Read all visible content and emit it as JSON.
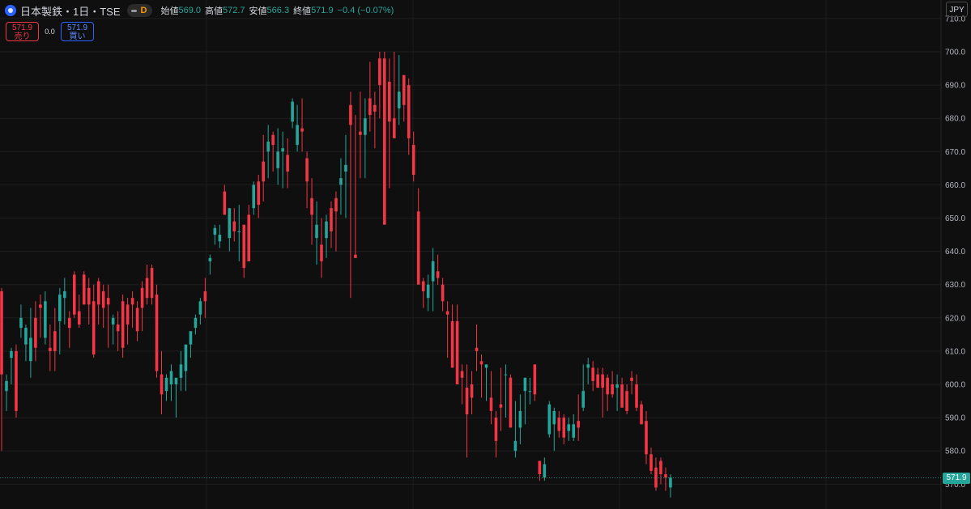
{
  "header": {
    "symbol_title": "日本製鉄・1日・TSE",
    "timeframe": "D",
    "ohlc": [
      {
        "label": "始値",
        "value": "569.0"
      },
      {
        "label": "高値",
        "value": "572.7"
      },
      {
        "label": "安値",
        "value": "566.3"
      },
      {
        "label": "終値",
        "value": "571.9"
      },
      {
        "label": "",
        "value": "−0.4 (−0.07%)"
      }
    ]
  },
  "trade": {
    "sell_price": "571.9",
    "sell_label": "売り",
    "spread": "0.0",
    "buy_price": "571.9",
    "buy_label": "買い"
  },
  "currency": "JPY",
  "last_price_label": "571.9",
  "colors": {
    "up": "#26a69a",
    "down": "#f23645",
    "background": "#0f0f0f",
    "grid": "#1e1e1e",
    "accent": "#2962ff"
  },
  "chart_data": {
    "type": "candlestick",
    "title": "",
    "xlabel": "",
    "ylabel": "",
    "ylim": [
      566,
      712
    ],
    "y_ticks": [
      570,
      580,
      590,
      600,
      610,
      620,
      630,
      640,
      650,
      660,
      670,
      680,
      690,
      700,
      710
    ],
    "grid": true,
    "last_close": 571.9,
    "candles": [
      [
        628,
        629,
        580,
        603
      ],
      [
        598,
        603,
        592,
        601
      ],
      [
        608,
        611,
        600,
        610
      ],
      [
        610,
        612,
        590,
        592
      ],
      [
        617,
        624,
        614,
        620
      ],
      [
        612,
        618,
        607,
        617
      ],
      [
        607,
        623,
        602,
        614
      ],
      [
        620,
        625,
        607,
        611
      ],
      [
        624,
        627,
        614,
        623
      ],
      [
        614,
        628,
        612,
        625
      ],
      [
        611,
        618,
        604,
        610
      ],
      [
        616,
        623,
        604,
        610
      ],
      [
        619,
        629,
        609,
        627
      ],
      [
        626,
        632,
        618,
        628
      ],
      [
        620,
        622,
        611,
        617
      ],
      [
        633,
        634,
        620,
        621
      ],
      [
        622,
        627,
        617,
        618
      ],
      [
        633,
        634,
        624,
        624
      ],
      [
        629,
        632,
        618,
        624
      ],
      [
        625,
        630,
        608,
        609
      ],
      [
        631,
        632,
        618,
        624
      ],
      [
        628,
        630,
        617,
        623
      ],
      [
        626,
        630,
        611,
        624
      ],
      [
        618,
        621,
        612,
        620
      ],
      [
        618,
        622,
        610,
        616
      ],
      [
        625,
        627,
        608,
        611
      ],
      [
        624,
        626,
        612,
        618
      ],
      [
        626,
        628,
        617,
        624
      ],
      [
        623,
        625,
        613,
        616
      ],
      [
        629,
        631,
        616,
        623
      ],
      [
        632,
        636,
        624,
        626
      ],
      [
        635,
        636,
        624,
        626
      ],
      [
        627,
        630,
        602,
        604
      ],
      [
        603,
        610,
        591,
        597
      ],
      [
        598,
        603,
        595,
        602
      ],
      [
        600,
        606,
        595,
        604
      ],
      [
        600,
        601,
        590,
        602
      ],
      [
        602,
        610,
        598,
        606
      ],
      [
        604,
        607,
        598,
        612
      ],
      [
        612,
        616,
        608,
        616
      ],
      [
        617,
        621,
        615,
        620
      ],
      [
        621,
        626,
        618,
        625
      ],
      [
        628,
        632,
        620,
        625
      ],
      [
        637,
        639,
        633,
        638
      ],
      [
        645,
        648,
        642,
        647
      ],
      [
        643,
        648,
        641,
        645
      ],
      [
        658,
        660,
        651,
        651
      ],
      [
        644,
        652,
        640,
        653
      ],
      [
        649,
        653,
        643,
        646
      ],
      [
        646,
        654,
        637,
        646
      ],
      [
        648,
        648,
        632,
        635
      ],
      [
        651,
        654,
        638,
        637
      ],
      [
        653,
        661,
        651,
        660
      ],
      [
        661,
        663,
        650,
        654
      ],
      [
        667,
        675,
        655,
        661
      ],
      [
        670,
        678,
        662,
        673
      ],
      [
        675,
        676,
        664,
        672
      ],
      [
        665,
        677,
        660,
        670
      ],
      [
        670,
        676,
        659,
        671
      ],
      [
        669,
        674,
        659,
        664
      ],
      [
        679,
        686,
        677,
        685
      ],
      [
        672,
        684,
        670,
        678
      ],
      [
        677,
        686,
        670,
        676
      ],
      [
        668,
        670,
        653,
        661
      ],
      [
        656,
        662,
        642,
        651
      ],
      [
        644,
        655,
        636,
        648
      ],
      [
        642,
        650,
        632,
        637
      ],
      [
        644,
        651,
        638,
        649
      ],
      [
        653,
        655,
        641,
        646
      ],
      [
        656,
        658,
        640,
        652
      ],
      [
        660,
        668,
        651,
        662
      ],
      [
        664,
        675,
        650,
        666
      ],
      [
        684,
        688,
        626,
        678
      ],
      [
        639,
        681,
        638,
        638
      ],
      [
        676,
        688,
        662,
        675
      ],
      [
        675,
        686,
        662,
        680
      ],
      [
        686,
        697,
        676,
        681
      ],
      [
        684,
        688,
        671,
        682
      ],
      [
        698,
        700,
        680,
        690
      ],
      [
        698,
        700,
        651,
        648
      ],
      [
        691,
        698,
        659,
        679
      ],
      [
        680,
        700,
        676,
        674
      ],
      [
        683,
        699,
        678,
        688
      ],
      [
        693,
        693,
        679,
        684
      ],
      [
        690,
        692,
        669,
        674
      ],
      [
        672,
        676,
        661,
        663
      ],
      [
        652,
        659,
        636,
        630
      ],
      [
        631,
        632,
        623,
        628
      ],
      [
        626,
        633,
        622,
        630
      ],
      [
        631,
        641,
        622,
        637
      ],
      [
        634,
        639,
        630,
        632
      ],
      [
        630,
        632,
        622,
        625
      ],
      [
        622,
        625,
        608,
        621
      ],
      [
        619,
        624,
        606,
        605
      ],
      [
        619,
        624,
        602,
        600
      ],
      [
        604,
        606,
        594,
        602
      ],
      [
        599,
        606,
        578,
        591
      ],
      [
        600,
        604,
        591,
        596
      ],
      [
        611,
        618,
        604,
        610
      ],
      [
        607,
        609,
        596,
        606
      ],
      [
        605,
        606,
        595,
        606
      ],
      [
        596,
        604,
        588,
        592
      ],
      [
        590,
        592,
        578,
        583
      ],
      [
        594,
        605,
        586,
        593
      ],
      [
        603,
        606,
        590,
        603
      ],
      [
        602,
        603,
        589,
        587
      ],
      [
        580,
        595,
        578,
        583
      ],
      [
        587,
        597,
        582,
        592
      ],
      [
        598,
        602,
        588,
        602
      ],
      [
        598,
        602,
        594,
        598
      ],
      [
        606,
        606,
        595,
        597
      ],
      [
        577,
        577,
        571,
        573
      ],
      [
        572,
        578,
        571,
        576
      ],
      [
        585,
        595,
        584,
        594
      ],
      [
        588,
        593,
        580,
        592
      ],
      [
        590,
        592,
        584,
        586
      ],
      [
        590,
        591,
        582,
        584
      ],
      [
        586,
        590,
        583,
        588
      ],
      [
        584,
        591,
        583,
        588
      ],
      [
        589,
        597,
        583,
        587
      ],
      [
        593,
        606,
        592,
        598
      ],
      [
        605,
        608,
        600,
        606
      ],
      [
        605,
        607,
        598,
        601
      ],
      [
        603,
        605,
        599,
        599
      ],
      [
        603,
        605,
        590,
        599
      ],
      [
        602,
        603,
        592,
        597
      ],
      [
        600,
        604,
        596,
        597
      ],
      [
        599,
        603,
        592,
        600
      ],
      [
        600,
        602,
        594,
        593
      ],
      [
        598,
        600,
        591,
        592
      ],
      [
        602,
        604,
        597,
        601
      ],
      [
        600,
        603,
        592,
        593
      ],
      [
        594,
        595,
        588,
        588
      ],
      [
        589,
        592,
        576,
        579
      ],
      [
        579,
        581,
        573,
        574
      ],
      [
        575,
        578,
        568,
        569
      ],
      [
        577,
        578,
        570,
        573
      ],
      [
        573,
        575,
        568,
        572
      ],
      [
        569,
        573,
        566,
        572
      ]
    ]
  }
}
